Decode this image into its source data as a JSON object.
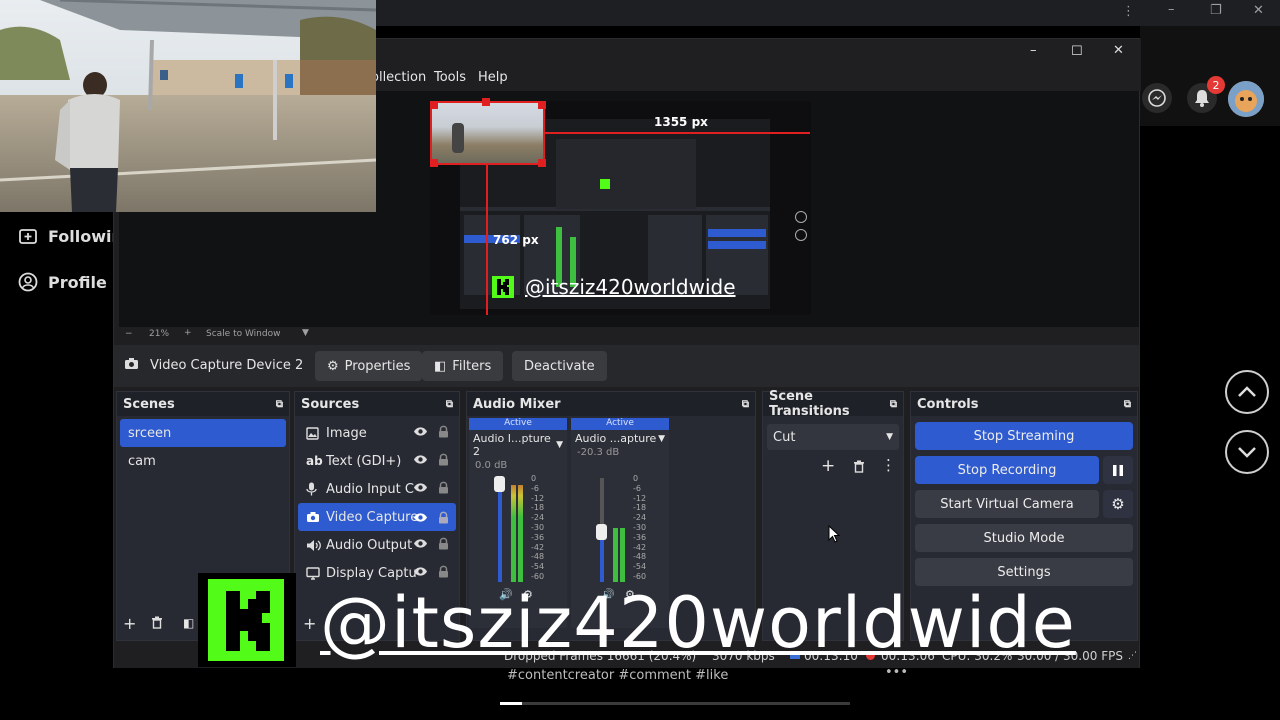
{
  "colors": {
    "accent_blue": "#2f5bd0",
    "kick_green": "#53fc18",
    "meter_green": "#3fbf3f",
    "meter_yellow": "#c9c236",
    "meter_red": "#c0392b",
    "notification_red": "#e53935"
  },
  "background_page": {
    "sidebar": {
      "following_label": "Following",
      "profile_label": "Profile"
    },
    "notification_count": "2",
    "hashtags": "#contentcreator #comment #like"
  },
  "obs": {
    "menu": {
      "collection": "ollection",
      "tools": "Tools",
      "help": "Help"
    },
    "preview": {
      "measure_horizontal": "1355 px",
      "measure_vertical": "762 px",
      "watermark": "@itsziz420worldwide"
    },
    "zoom": {
      "minus": "−",
      "percent": "21%",
      "plus": "+",
      "mode": "Scale to Window"
    },
    "source_toolbar": {
      "source_name": "Video Capture Device 2",
      "properties_label": "Properties",
      "filters_label": "Filters",
      "deactivate_label": "Deactivate"
    },
    "scenes": {
      "title": "Scenes",
      "items": [
        "srceen",
        "cam"
      ]
    },
    "sources": {
      "title": "Sources",
      "items": [
        {
          "label": "Image",
          "icon": "image-icon"
        },
        {
          "label": "Text (GDI+)",
          "icon": "text-icon"
        },
        {
          "label": "Audio Input C",
          "icon": "microphone-icon"
        },
        {
          "label": "Video Capture",
          "icon": "camera-icon"
        },
        {
          "label": "Audio Output",
          "icon": "speaker-icon"
        },
        {
          "label": "Display Captu",
          "icon": "monitor-icon"
        }
      ]
    },
    "audio_mixer": {
      "title": "Audio Mixer",
      "channels": [
        {
          "status": "Active",
          "name": "Audio I...pture 2",
          "db": "0.0 dB",
          "level": 0.9
        },
        {
          "status": "Active",
          "name": "Audio ...apture",
          "db": "-20.3 dB",
          "level": 0.5
        }
      ],
      "scale": [
        "0",
        "-6",
        "-12",
        "-18",
        "-24",
        "-30",
        "-36",
        "-42",
        "-48",
        "-54",
        "-60"
      ]
    },
    "scene_transitions": {
      "title": "Scene Transitions",
      "selected": "Cut"
    },
    "controls": {
      "title": "Controls",
      "stop_streaming": "Stop Streaming",
      "stop_recording": "Stop Recording",
      "start_virtual_camera": "Start Virtual Camera",
      "studio_mode": "Studio Mode",
      "settings": "Settings"
    },
    "statusbar": {
      "dropped_frames": "Dropped Frames 16661 (20.4%)",
      "bitrate": "3070 kbps",
      "stream_time": "00:13:10",
      "record_time": "00:13:06",
      "cpu": "CPU: 30.2%",
      "fps": "30.00 / 30.00 FPS"
    }
  },
  "overlay": {
    "watermark": "@itsziz420worldwide"
  }
}
